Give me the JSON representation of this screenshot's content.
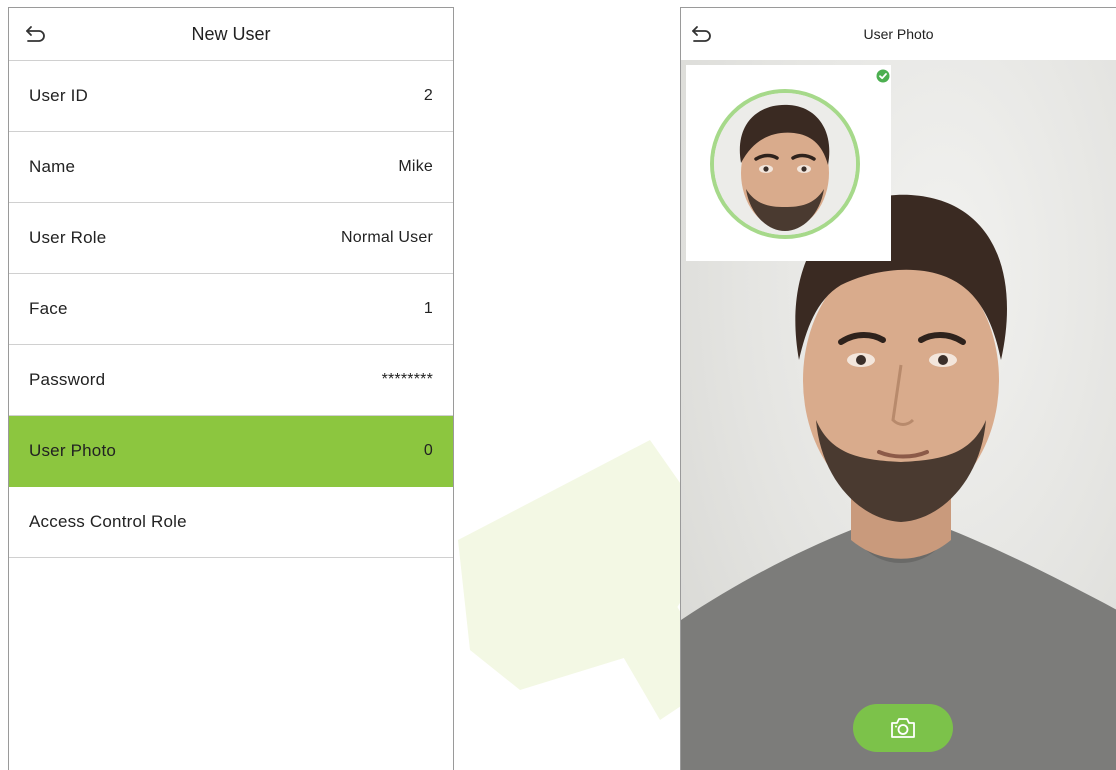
{
  "left_screen": {
    "title": "New User",
    "items": [
      {
        "label": "User ID",
        "value": "2"
      },
      {
        "label": "Name",
        "value": "Mike"
      },
      {
        "label": "User Role",
        "value": "Normal User"
      },
      {
        "label": "Face",
        "value": "1"
      },
      {
        "label": "Password",
        "value": "********"
      },
      {
        "label": "User Photo",
        "value": "0"
      },
      {
        "label": "Access Control Role",
        "value": ""
      }
    ],
    "active_index": 5
  },
  "right_screen": {
    "title": "User Photo"
  },
  "colors": {
    "accent": "#8cc63f",
    "camera_button": "#7cc24a",
    "thumb_ring": "#a6d98a",
    "check": "#4caf50"
  },
  "icons": [
    "back-arrow-icon",
    "check-circle-icon",
    "camera-icon"
  ]
}
